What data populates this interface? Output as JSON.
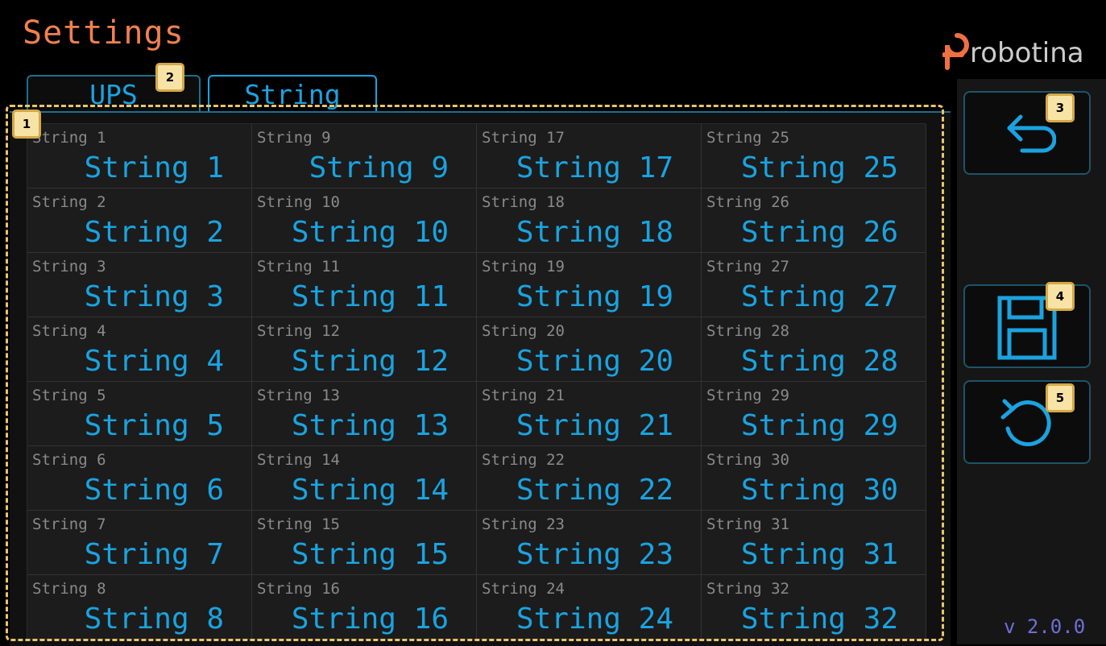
{
  "header": {
    "title": "Settings",
    "logo_text": "robotina"
  },
  "tabs": [
    {
      "label": "UPS",
      "active": false
    },
    {
      "label": "String",
      "active": true
    }
  ],
  "strings": [
    {
      "label": "String 1",
      "value": "String 1"
    },
    {
      "label": "String 2",
      "value": "String 2"
    },
    {
      "label": "String 3",
      "value": "String 3"
    },
    {
      "label": "String 4",
      "value": "String 4"
    },
    {
      "label": "String 5",
      "value": "String 5"
    },
    {
      "label": "String 6",
      "value": "String 6"
    },
    {
      "label": "String 7",
      "value": "String 7"
    },
    {
      "label": "String 8",
      "value": "String 8"
    },
    {
      "label": "String 9",
      "value": "String 9"
    },
    {
      "label": "String 10",
      "value": "String 10"
    },
    {
      "label": "String 11",
      "value": "String 11"
    },
    {
      "label": "String 12",
      "value": "String 12"
    },
    {
      "label": "String 13",
      "value": "String 13"
    },
    {
      "label": "String 14",
      "value": "String 14"
    },
    {
      "label": "String 15",
      "value": "String 15"
    },
    {
      "label": "String 16",
      "value": "String 16"
    },
    {
      "label": "String 17",
      "value": "String 17"
    },
    {
      "label": "String 18",
      "value": "String 18"
    },
    {
      "label": "String 19",
      "value": "String 19"
    },
    {
      "label": "String 20",
      "value": "String 20"
    },
    {
      "label": "String 21",
      "value": "String 21"
    },
    {
      "label": "String 22",
      "value": "String 22"
    },
    {
      "label": "String 23",
      "value": "String 23"
    },
    {
      "label": "String 24",
      "value": "String 24"
    },
    {
      "label": "String 25",
      "value": "String 25"
    },
    {
      "label": "String 26",
      "value": "String 26"
    },
    {
      "label": "String 27",
      "value": "String 27"
    },
    {
      "label": "String 28",
      "value": "String 28"
    },
    {
      "label": "String 29",
      "value": "String 29"
    },
    {
      "label": "String 30",
      "value": "String 30"
    },
    {
      "label": "String 31",
      "value": "String 31"
    },
    {
      "label": "String 32",
      "value": "String 32"
    }
  ],
  "sidebar": {
    "buttons": [
      {
        "icon": "back-arrow-icon"
      },
      {
        "icon": "save-icon"
      },
      {
        "icon": "undo-icon"
      }
    ]
  },
  "callouts": [
    "1",
    "2",
    "3",
    "4",
    "5"
  ],
  "version": "v 2.0.0",
  "colors": {
    "title": "#f08050",
    "accent": "#1aa3e0",
    "label": "#8a8a8a",
    "highlight": "#e9c46a",
    "version": "#6f6fd6",
    "logo_mark": "#f07040"
  }
}
